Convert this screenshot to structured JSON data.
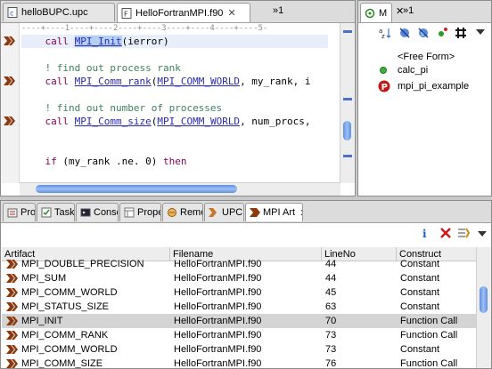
{
  "editor": {
    "tabs": [
      {
        "label": "helloBUPC.upc",
        "active": false
      },
      {
        "label": "HelloFortranMPI.f90",
        "active": true
      }
    ],
    "overflow_label": "»1",
    "ruler": "----+----1----+----2----+----3----+----4----+----5-",
    "lines": [
      {
        "indent": "    ",
        "parts": [
          {
            "t": "call ",
            "c": "kw"
          },
          {
            "t": "MPI_Init",
            "c": "fn sel"
          },
          {
            "t": "(ierror)",
            "c": ""
          }
        ],
        "marker": true,
        "current": true
      },
      {
        "indent": "",
        "parts": [],
        "marker": false
      },
      {
        "indent": "    ",
        "parts": [
          {
            "t": "! find out process rank",
            "c": "cm"
          }
        ],
        "marker": false
      },
      {
        "indent": "    ",
        "parts": [
          {
            "t": "call ",
            "c": "kw"
          },
          {
            "t": "MPI_Comm_rank",
            "c": "fn"
          },
          {
            "t": "(",
            "c": ""
          },
          {
            "t": "MPI_COMM_WORLD",
            "c": "fn"
          },
          {
            "t": ", my_rank, i",
            "c": ""
          }
        ],
        "marker": true
      },
      {
        "indent": "",
        "parts": [],
        "marker": false
      },
      {
        "indent": "    ",
        "parts": [
          {
            "t": "! find out number of processes",
            "c": "cm"
          }
        ],
        "marker": false
      },
      {
        "indent": "    ",
        "parts": [
          {
            "t": "call ",
            "c": "kw"
          },
          {
            "t": "MPI_Comm_size",
            "c": "fn"
          },
          {
            "t": "(",
            "c": ""
          },
          {
            "t": "MPI_COMM_WORLD",
            "c": "fn"
          },
          {
            "t": ", num_procs,",
            "c": ""
          }
        ],
        "marker": true
      },
      {
        "indent": "",
        "parts": [],
        "marker": false
      },
      {
        "indent": "",
        "parts": [],
        "marker": false
      },
      {
        "indent": "    ",
        "parts": [
          {
            "t": "if ",
            "c": "kw"
          },
          {
            "t": "(my_rank .ne. 0) ",
            "c": ""
          },
          {
            "t": "then",
            "c": "kw"
          }
        ],
        "marker": false
      }
    ]
  },
  "outline": {
    "tab_label": "M",
    "overflow_label": "»1",
    "items": [
      {
        "label": "<Free Form>",
        "icon": "none"
      },
      {
        "label": "calc_pi",
        "icon": "green-dot-icon"
      },
      {
        "label": "mpi_pi_example",
        "icon": "program-p-icon"
      }
    ]
  },
  "bottom": {
    "tabs": [
      {
        "label": "Proble",
        "icon": "problems-icon"
      },
      {
        "label": "Tasks",
        "icon": "tasks-icon"
      },
      {
        "label": "Consol",
        "icon": "console-icon"
      },
      {
        "label": "Proper",
        "icon": "properties-icon"
      },
      {
        "label": "Remot",
        "icon": "remote-icon"
      },
      {
        "label": "UPC Ar",
        "icon": "upc-artifact-icon"
      },
      {
        "label": "MPI Art",
        "icon": "mpi-artifact-icon",
        "active": true
      }
    ],
    "columns": [
      "Artifact",
      "Filename",
      "LineNo",
      "Construct"
    ],
    "rows": [
      [
        "MPI_DOUBLE_PRECISION",
        "HelloFortranMPI.f90",
        "44",
        "Constant"
      ],
      [
        "MPI_SUM",
        "HelloFortranMPI.f90",
        "44",
        "Constant"
      ],
      [
        "MPI_COMM_WORLD",
        "HelloFortranMPI.f90",
        "45",
        "Constant"
      ],
      [
        "MPI_STATUS_SIZE",
        "HelloFortranMPI.f90",
        "63",
        "Constant"
      ],
      [
        "MPI_INIT",
        "HelloFortranMPI.f90",
        "70",
        "Function Call"
      ],
      [
        "MPI_COMM_RANK",
        "HelloFortranMPI.f90",
        "73",
        "Function Call"
      ],
      [
        "MPI_COMM_WORLD",
        "HelloFortranMPI.f90",
        "73",
        "Constant"
      ],
      [
        "MPI_COMM_SIZE",
        "HelloFortranMPI.f90",
        "76",
        "Function Call"
      ]
    ],
    "selected_row": 4
  },
  "colors": {
    "accent": "#4f70c8",
    "marker": "#8b3a10",
    "keyword": "#7f0055",
    "comment": "#3f7f5f"
  }
}
